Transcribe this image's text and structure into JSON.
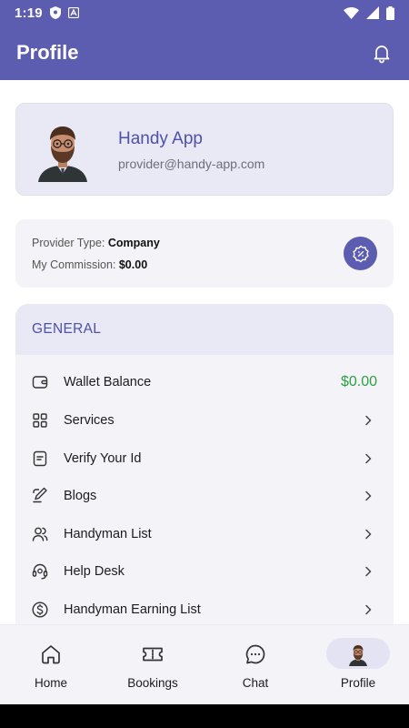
{
  "status_bar": {
    "time": "1:19"
  },
  "app_bar": {
    "title": "Profile"
  },
  "profile": {
    "name": "Handy App",
    "email": "provider@handy-app.com"
  },
  "provider_info": {
    "type_label": "Provider Type:",
    "type_value": "Company",
    "commission_label": "My Commission:",
    "commission_value": "$0.00"
  },
  "general": {
    "header": "GENERAL",
    "items": [
      {
        "label": "Wallet Balance",
        "value": "$0.00",
        "icon": "wallet-icon"
      },
      {
        "label": "Services",
        "icon": "grid-icon"
      },
      {
        "label": "Verify Your Id",
        "icon": "document-icon"
      },
      {
        "label": "Blogs",
        "icon": "pen-icon"
      },
      {
        "label": "Handyman List",
        "icon": "users-icon"
      },
      {
        "label": "Help Desk",
        "icon": "headset-icon"
      },
      {
        "label": "Handyman Earning List",
        "icon": "dollar-icon"
      }
    ]
  },
  "bottom_nav": {
    "items": [
      {
        "label": "Home",
        "icon": "home-icon"
      },
      {
        "label": "Bookings",
        "icon": "ticket-icon"
      },
      {
        "label": "Chat",
        "icon": "chat-icon"
      },
      {
        "label": "Profile",
        "icon": "avatar-icon",
        "active": true
      }
    ]
  },
  "colors": {
    "primary": "#5c5cb0",
    "card": "#e9e9f6",
    "surface": "#f4f4f8",
    "positive": "#2ea043"
  }
}
